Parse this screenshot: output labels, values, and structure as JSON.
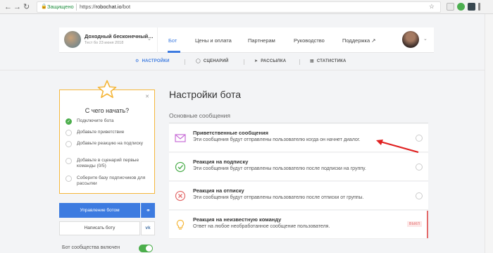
{
  "browser": {
    "secure_label": "Защищено",
    "url_scheme": "https://",
    "url_host": "robochat.io",
    "url_path": "/bot"
  },
  "account": {
    "name": "Доходный бесконечный…",
    "subtitle": "Тест бо 23 июня 2018"
  },
  "topnav": {
    "items": [
      "Бот",
      "Цены и оплата",
      "Партнерам",
      "Руководство",
      "Поддержка ↗"
    ],
    "active_index": 0
  },
  "subnav": {
    "items": [
      {
        "label": "НАСТРОЙКИ",
        "icon": "gear-icon"
      },
      {
        "label": "СЦЕНАРИЙ",
        "icon": "chat-icon"
      },
      {
        "label": "РАССЫЛКА",
        "icon": "send-icon"
      },
      {
        "label": "СТАТИСТИКА",
        "icon": "stats-icon"
      }
    ],
    "active_index": 0
  },
  "onboarding": {
    "title": "С чего начать?",
    "steps": [
      {
        "label": "Подключите бота",
        "done": true
      },
      {
        "label": "Добавьте приветствие",
        "done": false
      },
      {
        "label": "Добавьте реакцию на подписку",
        "done": false
      },
      {
        "label": "Добавьте в сценарий первые команды (0/5)",
        "done": false
      },
      {
        "label": "Соберите базу подписчиков для рассылки",
        "done": false
      }
    ]
  },
  "sidebar_buttons": {
    "manage": "Управление ботом",
    "write": "Написать боту",
    "vk": "vk"
  },
  "bot_toggle": {
    "label": "Бот сообщества включен",
    "enabled": true
  },
  "main": {
    "title": "Настройки бота",
    "section_title": "Основные сообщения",
    "items": [
      {
        "title": "Приветственные сообщения",
        "desc": "Эти сообщения будут отправлены пользователю когда он начнет диалог.",
        "icon": "envelope-icon"
      },
      {
        "title": "Реакция на подписку",
        "desc": "Эти сообщения будут отправлены пользователю после подписки на группу.",
        "icon": "check-circle-icon"
      },
      {
        "title": "Реакция на отписку",
        "desc": "Эти сообщения будут отправлены пользователю после отписки от группы.",
        "icon": "x-circle-icon"
      },
      {
        "title": "Реакция на неизвестную команду",
        "desc": "Ответ на любое необработанное сообщение пользователя.",
        "icon": "lightbulb-icon",
        "badge": "ВЫКЛ"
      }
    ]
  },
  "colors": {
    "accent": "#3d7be0",
    "onboarding_border": "#f5b73c",
    "success": "#4cae4c",
    "danger": "#e36a6a"
  }
}
